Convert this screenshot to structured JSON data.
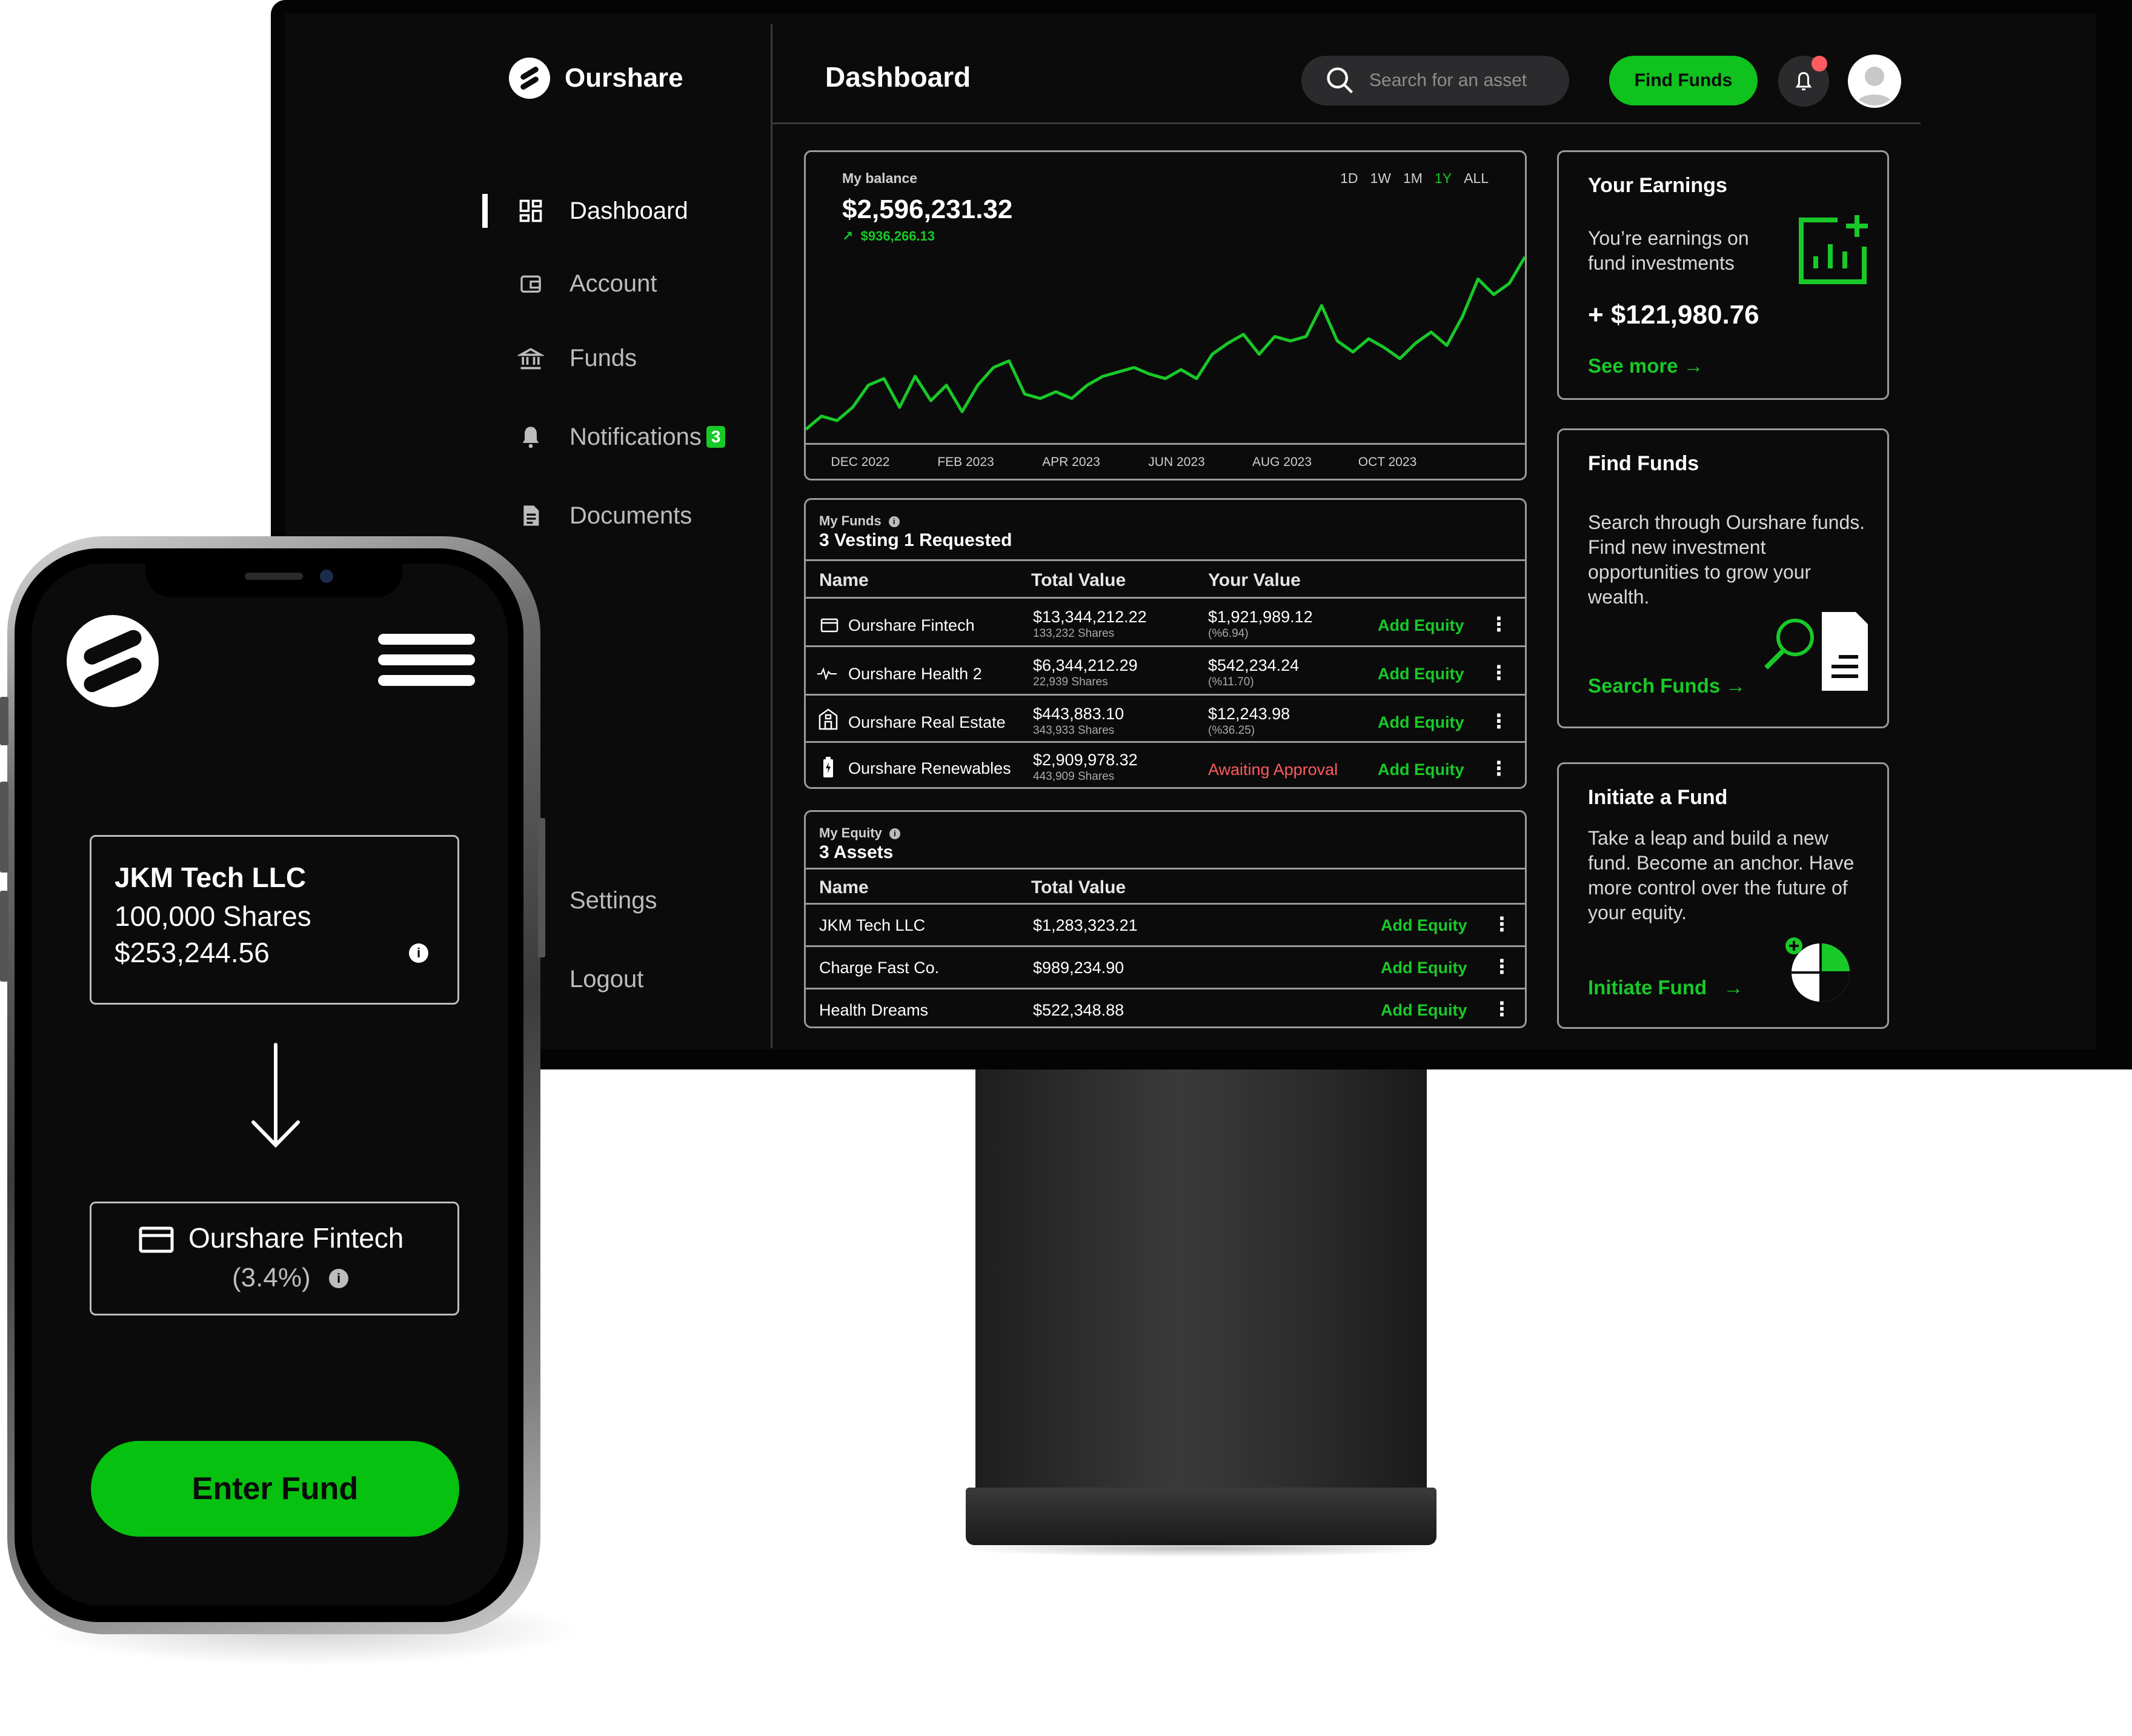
{
  "desktop": {
    "brand": {
      "name": "Ourshare"
    },
    "sidebar": {
      "items": [
        {
          "label": "Dashboard",
          "icon": "dashboard-grid-icon",
          "active": true
        },
        {
          "label": "Account",
          "icon": "wallet-icon"
        },
        {
          "label": "Funds",
          "icon": "bank-icon"
        },
        {
          "label": "Notifications",
          "icon": "bell-icon",
          "badge": "3"
        },
        {
          "label": "Documents",
          "icon": "document-icon"
        },
        {
          "label": "Settings",
          "icon": "gear-icon"
        },
        {
          "label": "Logout",
          "icon": "logout-icon"
        }
      ]
    },
    "header": {
      "title": "Dashboard",
      "search_placeholder": "Search for an asset",
      "find_funds_label": "Find Funds"
    },
    "balance": {
      "label": "My balance",
      "value": "$2,596,231.32",
      "change": "$936,266.13",
      "ranges": [
        "1D",
        "1W",
        "1M",
        "1Y",
        "ALL"
      ],
      "selected_range": "1Y"
    },
    "chart_data": {
      "type": "line",
      "title": "",
      "xlabel": "",
      "ylabel": "",
      "x_ticks": [
        "DEC 2022",
        "FEB 2023",
        "APR 2023",
        "JUN 2023",
        "AUG 2023",
        "OCT 2023"
      ],
      "series": [
        {
          "color": "#18c928",
          "values": [
            0.02,
            0.08,
            0.06,
            0.12,
            0.22,
            0.25,
            0.12,
            0.26,
            0.15,
            0.22,
            0.1,
            0.22,
            0.3,
            0.33,
            0.18,
            0.16,
            0.19,
            0.16,
            0.22,
            0.26,
            0.28,
            0.3,
            0.27,
            0.25,
            0.29,
            0.25,
            0.36,
            0.41,
            0.45,
            0.36,
            0.44,
            0.42,
            0.44,
            0.58,
            0.42,
            0.37,
            0.43,
            0.39,
            0.34,
            0.41,
            0.46,
            0.4,
            0.53,
            0.7,
            0.63,
            0.68,
            0.8
          ]
        }
      ]
    },
    "my_funds": {
      "label": "My Funds",
      "title": "3 Vesting 1 Requested",
      "columns": [
        "Name",
        "Total Value",
        "Your Value"
      ],
      "rows": [
        {
          "icon": "credit-card-icon",
          "name": "Ourshare Fintech",
          "total": "$13,344,212.22",
          "shares": "133,232 Shares",
          "your_value": "$1,921,989.12",
          "pct": "(%6.94)",
          "action": "Add Equity"
        },
        {
          "icon": "pulse-icon",
          "name": "Ourshare Health 2",
          "total": "$6,344,212.29",
          "shares": "22,939 Shares",
          "your_value": "$542,234.24",
          "pct": "(%11.70)",
          "action": "Add Equity"
        },
        {
          "icon": "building-icon",
          "name": "Ourshare Real Estate",
          "total": "$443,883.10",
          "shares": "343,933 Shares",
          "your_value": "$12,243.98",
          "pct": "(%36.25)",
          "action": "Add Equity"
        },
        {
          "icon": "battery-icon",
          "name": "Ourshare Renewables",
          "total": "$2,909,978.32",
          "shares": "443,909 Shares",
          "your_value": "Awaiting Approval",
          "pct": "",
          "action": "Add Equity"
        }
      ]
    },
    "my_equity": {
      "label": "My Equity",
      "title": "3 Assets",
      "columns": [
        "Name",
        "Total Value"
      ],
      "rows": [
        {
          "name": "JKM Tech LLC",
          "total": "$1,283,323.21",
          "action": "Add Equity"
        },
        {
          "name": "Charge Fast Co.",
          "total": "$989,234.90",
          "action": "Add Equity"
        },
        {
          "name": "Health Dreams",
          "total": "$522,348.88",
          "action": "Add Equity"
        }
      ]
    },
    "earnings": {
      "title": "Your Earnings",
      "text": "You’re earnings on fund investments",
      "amount": "+ $121,980.76",
      "link": "See more"
    },
    "find_funds": {
      "title": "Find Funds",
      "text": "Search through Ourshare funds. Find new investment opportunities to grow your wealth.",
      "link": "Search Funds"
    },
    "initiate": {
      "title": "Initiate a Fund",
      "text": "Take a leap and build a new fund. Become an anchor. Have more control over the future of your equity.",
      "link": "Initiate Fund"
    }
  },
  "mobile": {
    "asset": {
      "name": "JKM Tech LLC",
      "shares": "100,000 Shares",
      "value": "$253,244.56"
    },
    "fund": {
      "name": "Ourshare Fintech",
      "pct": "(3.4%)"
    },
    "enter_label": "Enter Fund"
  },
  "colors": {
    "accent": "#18c928",
    "background": "#0b0b0b",
    "alert": "#ff5a5f"
  }
}
